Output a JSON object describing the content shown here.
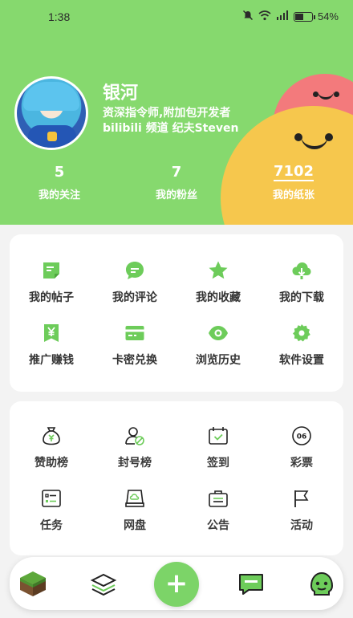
{
  "status": {
    "time": "1:38",
    "battery": "54%",
    "battery_level": 0.54
  },
  "profile": {
    "name": "银河",
    "bio_line1": "资深指令师,附加包开发者",
    "bio_line2": "bilibili 频道 纪夫Steven"
  },
  "stats": [
    {
      "num": "5",
      "label": "我的关注"
    },
    {
      "num": "7",
      "label": "我的粉丝"
    },
    {
      "num": "7102",
      "label": "我的纸张"
    }
  ],
  "menu1": [
    {
      "label": "我的帖子",
      "icon": "post-icon"
    },
    {
      "label": "我的评论",
      "icon": "comment-icon"
    },
    {
      "label": "我的收藏",
      "icon": "star-icon"
    },
    {
      "label": "我的下载",
      "icon": "cloud-download-icon"
    },
    {
      "label": "推广赚钱",
      "icon": "yen-icon"
    },
    {
      "label": "卡密兑换",
      "icon": "card-icon"
    },
    {
      "label": "浏览历史",
      "icon": "eye-icon"
    },
    {
      "label": "软件设置",
      "icon": "gear-icon"
    }
  ],
  "menu2": [
    {
      "label": "赞助榜",
      "icon": "money-bag-icon"
    },
    {
      "label": "封号榜",
      "icon": "banned-user-icon"
    },
    {
      "label": "签到",
      "icon": "calendar-check-icon"
    },
    {
      "label": "彩票",
      "icon": "lottery-ball-icon",
      "badge": "06"
    },
    {
      "label": "任务",
      "icon": "task-list-icon"
    },
    {
      "label": "网盘",
      "icon": "cloud-drive-icon"
    },
    {
      "label": "公告",
      "icon": "announcement-icon"
    },
    {
      "label": "活动",
      "icon": "flag-icon"
    }
  ],
  "nav": {
    "fab": "+",
    "items": [
      "grass-block-icon",
      "layers-icon",
      "chat-icon",
      "creeper-face-icon"
    ]
  },
  "colors": {
    "accent": "#86d96e",
    "icon_green": "#6dcc5a",
    "pink": "#f37a7c",
    "yellow": "#f6c74d"
  }
}
